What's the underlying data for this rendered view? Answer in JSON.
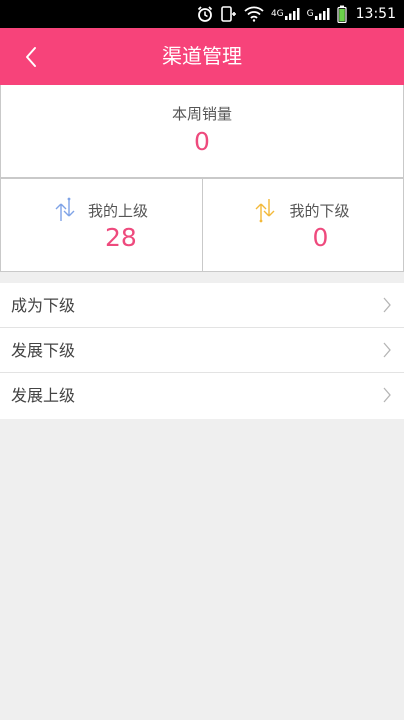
{
  "status_bar": {
    "time": "13:51",
    "signal_label_1": "4G",
    "signal_label_2": "G"
  },
  "header": {
    "title": "渠道管理",
    "back_icon": "chevron-left-icon"
  },
  "weekly_sales": {
    "label": "本周销量",
    "value": "0"
  },
  "superiors": {
    "label": "我的上级",
    "value": "28",
    "icon": "arrows-up-down-icon",
    "icon_color": "#7fa3e6"
  },
  "subordinates": {
    "label": "我的下级",
    "value": "0",
    "icon": "arrows-up-down-icon",
    "icon_color": "#f3b93a"
  },
  "menu": [
    {
      "label": "成为下级"
    },
    {
      "label": "发展下级"
    },
    {
      "label": "发展上级"
    }
  ],
  "colors": {
    "header_bg": "#f7437a",
    "value_text": "#ee4a7d",
    "page_bg": "#efefef"
  }
}
